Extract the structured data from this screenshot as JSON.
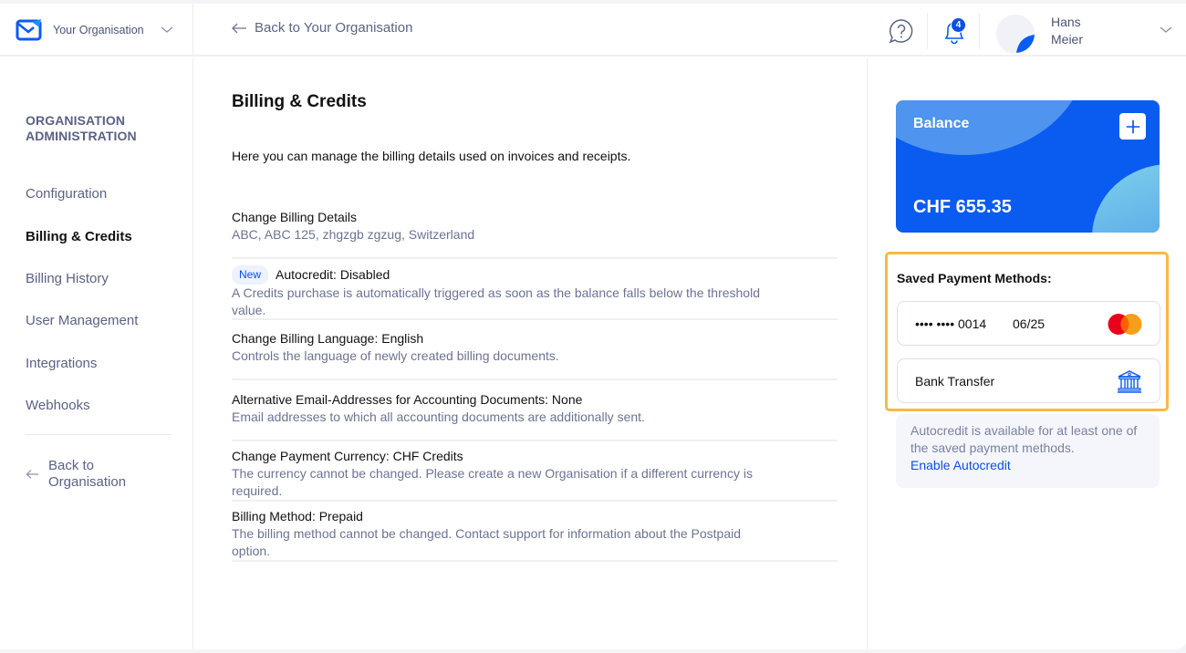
{
  "header": {
    "org_name": "Your Organisation",
    "back_link": "Back to Your Organisation",
    "notifications_count": "4",
    "user_first": "Hans",
    "user_last": "Meier"
  },
  "sidebar": {
    "title_line1": "ORGANISATION",
    "title_line2": "ADMINISTRATION",
    "items": [
      {
        "label": "Configuration",
        "active": false
      },
      {
        "label": "Billing & Credits",
        "active": true
      },
      {
        "label": "Billing History",
        "active": false
      },
      {
        "label": "User Management",
        "active": false
      },
      {
        "label": "Integrations",
        "active": false
      },
      {
        "label": "Webhooks",
        "active": false
      }
    ],
    "back_line1": "Back to",
    "back_line2": "Organisation"
  },
  "main": {
    "title": "Billing & Credits",
    "intro": "Here you can manage the billing details used on invoices and receipts.",
    "settings": [
      {
        "title": "Change Billing Details",
        "desc": "ABC, ABC 125, zhgzgb zgzug, Switzerland"
      },
      {
        "badge": "New",
        "title": "Autocredit: Disabled",
        "desc": "A Credits purchase is automatically triggered as soon as the balance falls below the threshold value."
      },
      {
        "title": "Change Billing Language: English",
        "desc": "Controls the language of newly created billing documents."
      },
      {
        "title": "Alternative Email-Addresses for Accounting Documents: None",
        "desc": "Email addresses to which all accounting documents are additionally sent."
      },
      {
        "title": "Change Payment Currency: CHF Credits",
        "desc": "The currency cannot be changed. Please create a new Organisation if a different currency is required."
      },
      {
        "title": "Billing Method: Prepaid",
        "desc": "The billing method cannot be changed. Contact support for information about the Postpaid option."
      }
    ]
  },
  "balance": {
    "label": "Balance",
    "amount": "CHF 655.35",
    "accent": "#0a5bf0"
  },
  "payment_methods": {
    "title": "Saved Payment Methods:",
    "card": {
      "number": "•••• •••• 0014",
      "expiry": "06/25",
      "brand_icon": "mastercard-icon"
    },
    "bank": {
      "label": "Bank Transfer",
      "icon": "bank-icon"
    },
    "highlight_color": "#f6b946"
  },
  "autocredit_info": {
    "text": "Autocredit is available for at least one of the saved payment methods.",
    "link": "Enable Autocredit"
  }
}
